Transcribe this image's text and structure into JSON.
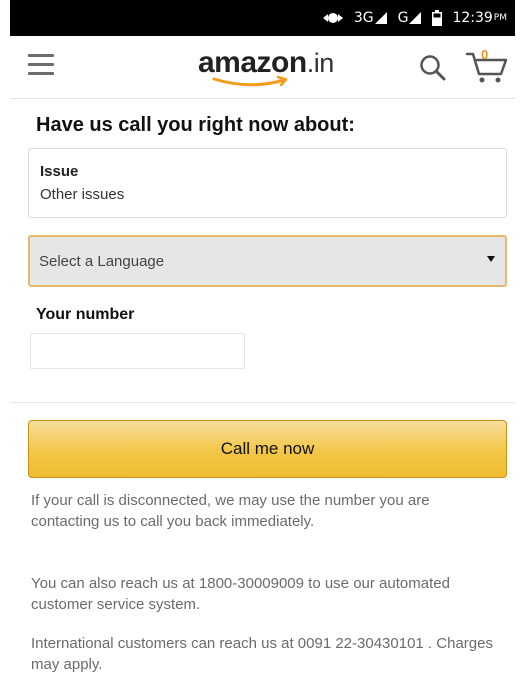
{
  "status_bar": {
    "network": "3G",
    "network_secondary": "G",
    "time": "12:39",
    "ampm": "PM",
    "icons": [
      "data-sync-icon",
      "signal-icon",
      "signal-icon",
      "battery-icon"
    ]
  },
  "header": {
    "logo_text": "amazon",
    "logo_suffix": ".in",
    "cart_count": "0",
    "icons": [
      "menu-icon",
      "search-icon",
      "cart-icon"
    ]
  },
  "form": {
    "heading": "Have us call you right now about:",
    "issue_label": "Issue",
    "issue_value": "Other issues",
    "language_select": "Select a Language",
    "number_label": "Your number",
    "number_value": "",
    "call_button": "Call me now"
  },
  "notes": [
    "If your call is disconnected, we may use the number you are contacting us to call you back immediately.",
    "You can also reach us at 1800-30009009 to use our automated customer service system.",
    "International customers can reach us at 0091 22-30430101 . Charges may apply."
  ],
  "colors": {
    "button_top": "#f7de9b",
    "button_bottom": "#efbd32",
    "select_border": "#e6ba6b",
    "cart_badge": "#e79622"
  }
}
